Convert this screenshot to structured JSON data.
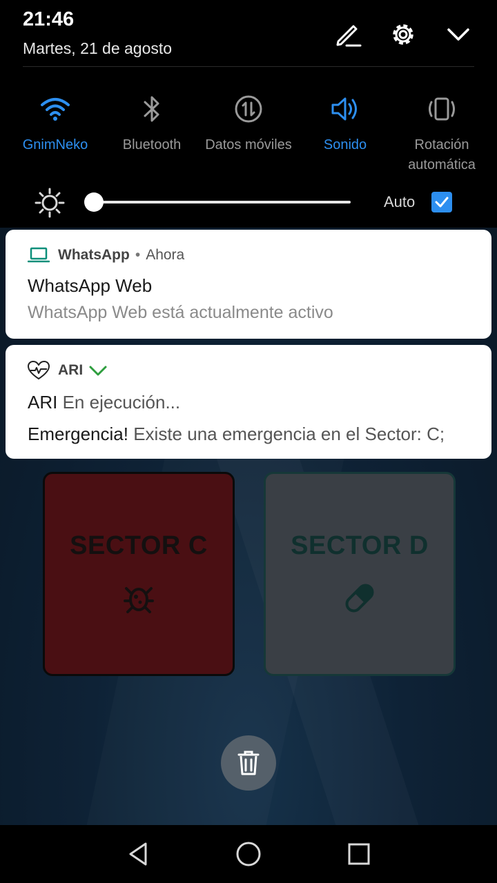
{
  "status": {
    "time": "21:46",
    "date": "Martes, 21 de agosto"
  },
  "header_icons": [
    "edit-icon",
    "settings-gear-icon",
    "collapse-chevron-icon"
  ],
  "quick_tiles": [
    {
      "label": "GnimNeko",
      "icon": "wifi-icon",
      "active": true
    },
    {
      "label": "Bluetooth",
      "icon": "bluetooth-icon",
      "active": false
    },
    {
      "label": "Datos móviles",
      "icon": "mobile-data-icon",
      "active": false
    },
    {
      "label": "Sonido",
      "icon": "sound-icon",
      "active": true
    },
    {
      "label": "Rotación automática",
      "icon": "auto-rotate-icon",
      "active": false
    }
  ],
  "brightness": {
    "level": 0.0,
    "auto_label": "Auto",
    "auto_checked": true
  },
  "notifications": {
    "whatsapp": {
      "app_name": "WhatsApp",
      "time": "Ahora",
      "title": "WhatsApp Web",
      "text": "WhatsApp Web está actualmente activo"
    },
    "ari": {
      "app_name": "ARI",
      "line1_title": "ARI",
      "line1_text": "En ejecución...",
      "line2_title": "Emergencia!",
      "line2_text": "Existe una emergencia en el Sector: C;"
    }
  },
  "background_app": {
    "sectors": [
      {
        "label": "SECTOR C",
        "icon": "virus-icon",
        "color": "#4a0f13"
      },
      {
        "label": "SECTOR D",
        "icon": "pill-icon",
        "color": "#3a3f45"
      }
    ]
  },
  "colors": {
    "accent": "#2d8ff0",
    "ari_check": "#2e9e3e"
  },
  "navbar": [
    "back-icon",
    "home-icon",
    "recents-icon"
  ]
}
